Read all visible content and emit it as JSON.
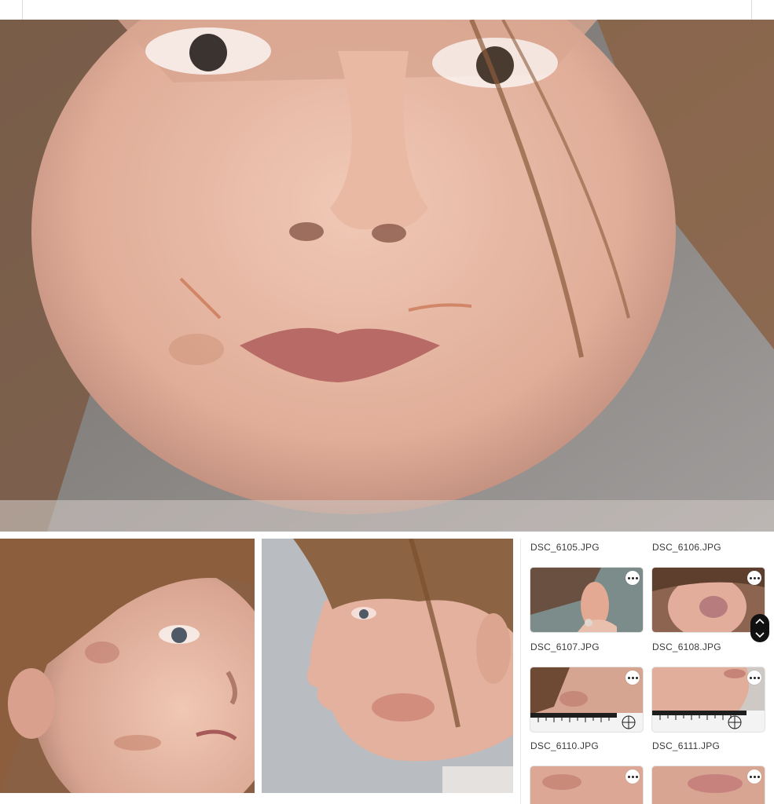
{
  "colors": {
    "background": "#ffffff",
    "skin": "#e7b9a4",
    "hair": "#8a5a3a",
    "backdrop": "#8c8c8c",
    "scroll_control": "#111111"
  },
  "icons": {
    "more": "more-icon",
    "scroll_up": "chevron-up-icon",
    "scroll_down": "chevron-down-icon"
  },
  "file_browser": {
    "rows": [
      {
        "left": {
          "filename": "DSC_6105.JPG"
        },
        "right": {
          "filename": "DSC_6106.JPG"
        }
      },
      {
        "left": {
          "filename": "DSC_6107.JPG"
        },
        "right": {
          "filename": "DSC_6108.JPG"
        }
      },
      {
        "left": {
          "filename": "DSC_6110.JPG"
        },
        "right": {
          "filename": "DSC_6111.JPG"
        }
      }
    ]
  }
}
